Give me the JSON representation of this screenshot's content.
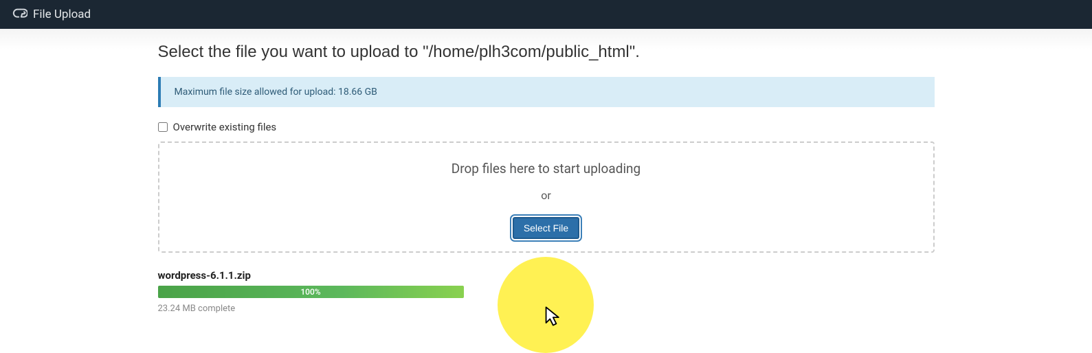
{
  "header": {
    "title": "File Upload"
  },
  "page": {
    "heading_prefix": "Select the file you want to upload to ",
    "upload_path": "\"/home/plh3com/public_html\"",
    "heading_suffix": "."
  },
  "alert": {
    "message": "Maximum file size allowed for upload: 18.66 GB"
  },
  "overwrite": {
    "label": "Overwrite existing files",
    "checked": false
  },
  "dropzone": {
    "drop_text": "Drop files here to start uploading",
    "or_text": "or",
    "select_button": "Select File"
  },
  "upload": {
    "filename": "wordpress-6.1.1.zip",
    "progress_percent": 100,
    "progress_label": "100%",
    "status": "23.24 MB complete"
  },
  "colors": {
    "header_bg": "#1b2733",
    "alert_bg": "#d9edf7",
    "alert_border": "#2c7cb4",
    "button_bg": "#2c6fa9",
    "progress_fill": "#5cb85c",
    "highlight": "#fff04a"
  }
}
